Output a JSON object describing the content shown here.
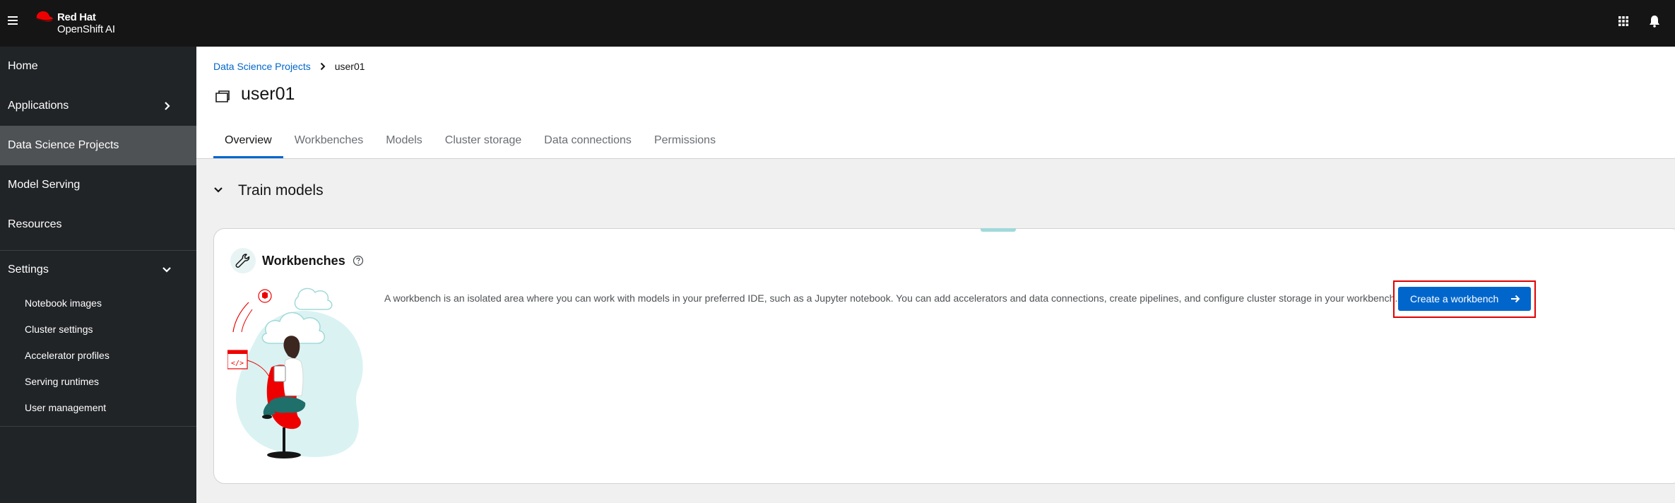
{
  "masthead": {
    "brand_top": "Red Hat",
    "brand_bottom": "OpenShift AI"
  },
  "sidebar": {
    "items": [
      {
        "label": "Home"
      },
      {
        "label": "Applications"
      },
      {
        "label": "Data Science Projects"
      },
      {
        "label": "Model Serving"
      },
      {
        "label": "Resources"
      },
      {
        "label": "Settings"
      }
    ],
    "settings_subitems": [
      {
        "label": "Notebook images"
      },
      {
        "label": "Cluster settings"
      },
      {
        "label": "Accelerator profiles"
      },
      {
        "label": "Serving runtimes"
      },
      {
        "label": "User management"
      }
    ]
  },
  "breadcrumb": {
    "parent": "Data Science Projects",
    "current": "user01"
  },
  "page": {
    "title": "user01"
  },
  "tabs": [
    {
      "label": "Overview"
    },
    {
      "label": "Workbenches"
    },
    {
      "label": "Models"
    },
    {
      "label": "Cluster storage"
    },
    {
      "label": "Data connections"
    },
    {
      "label": "Permissions"
    }
  ],
  "section": {
    "title": "Train models"
  },
  "workbenches_card": {
    "title": "Workbenches",
    "description": "A workbench is an isolated area where you can work with models in your preferred IDE, such as a Jupyter notebook. You can add accelerators and data connections, create pipelines, and configure cluster storage in your workbench.",
    "button_label": "Create a workbench"
  },
  "colors": {
    "masthead_bg": "#151515",
    "sidebar_bg": "#212427",
    "sidebar_active": "#4f5255",
    "primary_blue": "#0066cc",
    "highlight_red": "#e00000"
  },
  "icons": [
    "hamburger-icon",
    "redhat-logo",
    "app-launcher-icon",
    "bell-icon",
    "chevron-right-icon",
    "chevron-down-icon",
    "project-icon",
    "wrench-icon",
    "help-icon",
    "arrow-right-icon"
  ]
}
